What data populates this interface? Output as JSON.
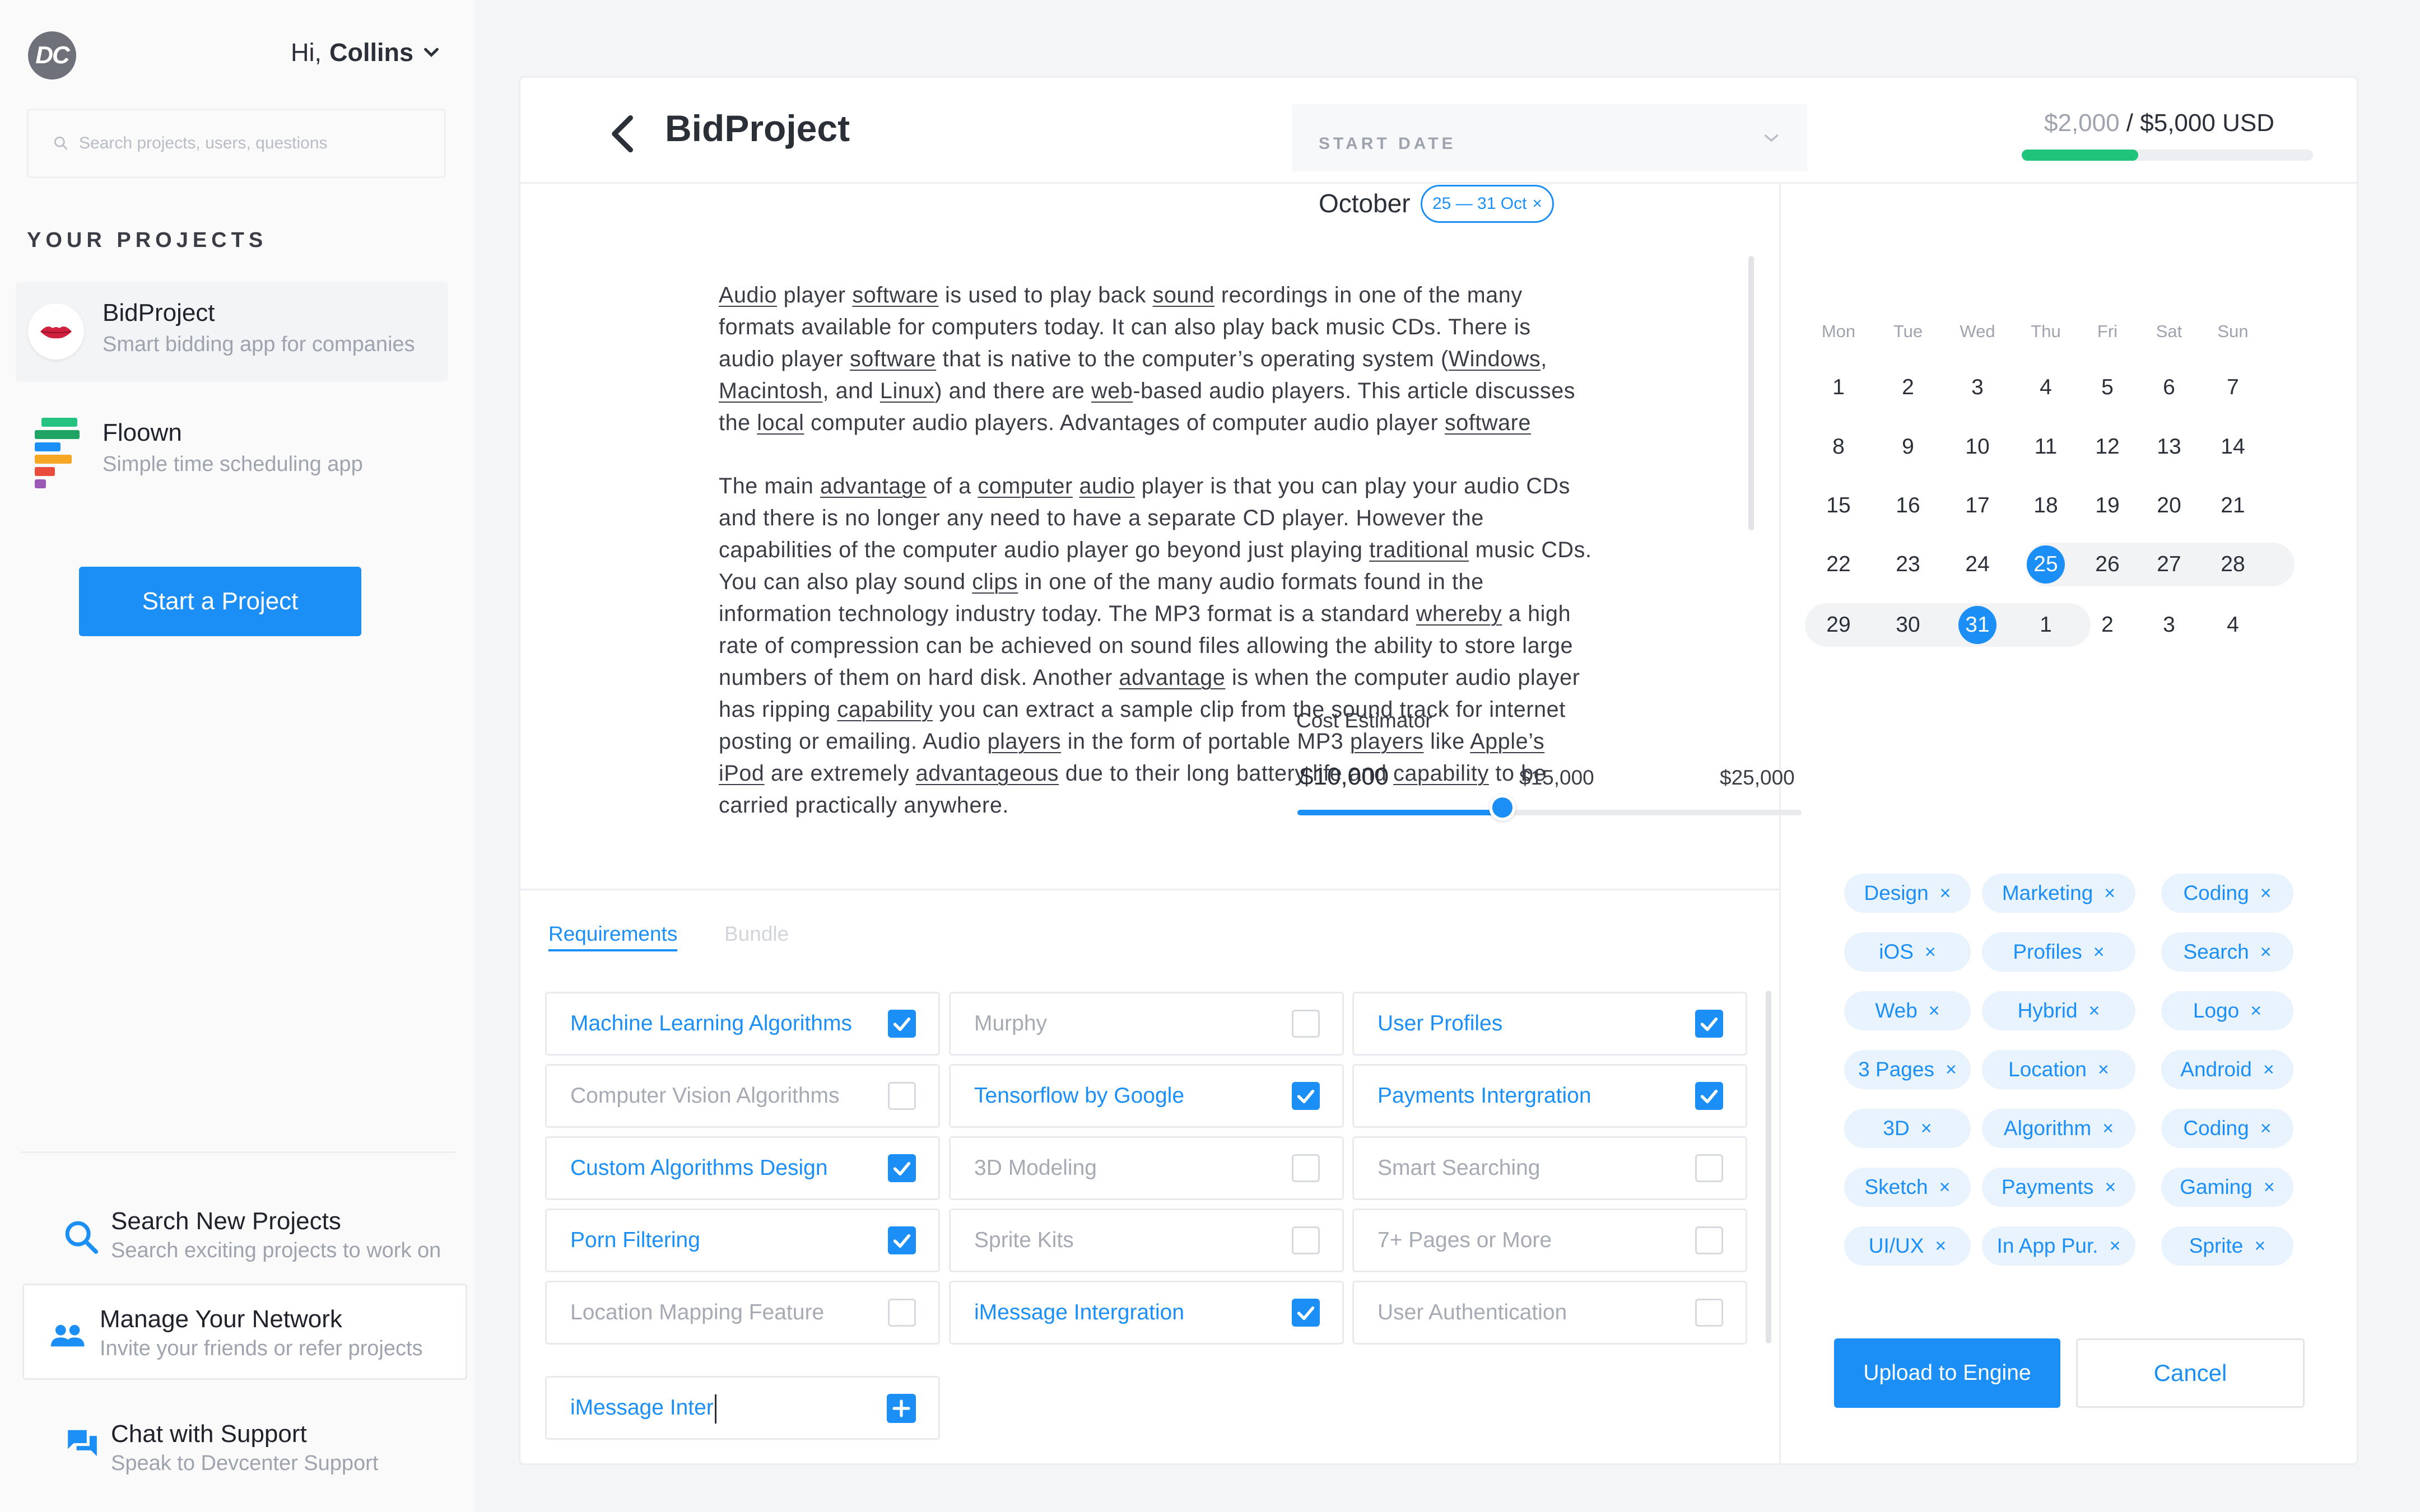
{
  "user": {
    "initials": "DC",
    "greeting": "Hi,",
    "name": "Collins"
  },
  "search": {
    "placeholder": "Search projects, users, questions"
  },
  "projects": {
    "heading": "YOUR PROJECTS",
    "items": [
      {
        "name": "BidProject",
        "subtitle": "Smart bidding app for companies"
      },
      {
        "name": "Floown",
        "subtitle": "Simple time scheduling app"
      }
    ],
    "start_label": "Start a Project"
  },
  "side_links": [
    {
      "title": "Search New Projects",
      "subtitle": "Search exciting projects to work on",
      "icon": "search-icon"
    },
    {
      "title": "Manage Your Network",
      "subtitle": "Invite your friends or refer projects",
      "icon": "people-icon"
    },
    {
      "title": "Chat with Support",
      "subtitle": "Speak to Devcenter Support",
      "icon": "chat-icon"
    }
  ],
  "header": {
    "title": "BidProject",
    "budget_current": "$2,000",
    "budget_sep": " / ",
    "budget_total": "$5,000 USD",
    "budget_progress": 0.4
  },
  "article": {
    "p1": "Audio player software is used to play back sound recordings in one of the many formats available for computers today. It can also play back music CDs. There is audio player software that is native to the computer’s operating system (Windows, Macintosh, and Linux) and there are web-based audio players. This article discusses the local computer audio players. Advantages of computer audio player software",
    "p2": "The main advantage of a computer audio player is that you can play your audio CDs and there is no longer any need to have a separate CD player. However the capabilities of the computer audio player go beyond just playing traditional music CDs. You can also play sound clips in one of the many audio formats found in the information technology industry today. The MP3 format is a standard whereby a high rate of compression can be achieved on sound files allowing the ability to store large numbers of them on hard disk. Another advantage is when the computer audio player has ripping capability you can extract a sample clip from the sound track for internet posting or emailing. Audio players in the form of portable MP3 players like Apple’s iPod are extremely advantageous due to their long battery life and capability to be carried practically anywhere."
  },
  "tabs": {
    "requirements": "Requirements",
    "bundle": "Bundle"
  },
  "requirements": [
    {
      "label": "Machine Learning Algorithms",
      "checked": true
    },
    {
      "label": "Murphy",
      "checked": false
    },
    {
      "label": "User Profiles",
      "checked": true
    },
    {
      "label": "Computer Vision Algorithms",
      "checked": false
    },
    {
      "label": "Tensorflow by Google",
      "checked": true
    },
    {
      "label": "Payments Intergration",
      "checked": true
    },
    {
      "label": "Custom Algorithms Design",
      "checked": true
    },
    {
      "label": "3D Modeling",
      "checked": false
    },
    {
      "label": "Smart Searching",
      "checked": false
    },
    {
      "label": "Porn Filtering",
      "checked": true
    },
    {
      "label": "Sprite Kits",
      "checked": false
    },
    {
      "label": "7+ Pages or More",
      "checked": false
    },
    {
      "label": "Location Mapping Feature",
      "checked": false
    },
    {
      "label": "iMessage Intergration",
      "checked": true
    },
    {
      "label": "User Authentication",
      "checked": false
    }
  ],
  "new_requirement": {
    "value": "iMessage Inter"
  },
  "start_date": {
    "label": "START DATE",
    "month": "October",
    "range": "25 — 31 Oct",
    "weekdays": [
      "Mon",
      "Tue",
      "Wed",
      "Thu",
      "Fri",
      "Sat",
      "Sun"
    ],
    "weeks": [
      [
        "1",
        "2",
        "3",
        "4",
        "5",
        "6",
        "7"
      ],
      [
        "8",
        "9",
        "10",
        "11",
        "12",
        "13",
        "14"
      ],
      [
        "15",
        "16",
        "17",
        "18",
        "19",
        "20",
        "21"
      ],
      [
        "22",
        "23",
        "24",
        "25",
        "26",
        "27",
        "28"
      ],
      [
        "29",
        "30",
        "31",
        "1",
        "2",
        "3",
        "4"
      ]
    ],
    "selected": [
      "25",
      "31"
    ]
  },
  "cost_estimator": {
    "label": "Cost Estimator",
    "min": "$10,000",
    "value": "$15,000",
    "max": "$25,000"
  },
  "tags": [
    "Design",
    "Marketing",
    "Coding",
    "iOS",
    "Profiles",
    "Search",
    "Web",
    "Hybrid",
    "Logo",
    "3 Pages",
    "Location",
    "Android",
    "3D",
    "Algorithm",
    "Coding",
    "Sketch",
    "Payments",
    "Gaming",
    "UI/UX",
    "In App Pur.",
    "Sprite"
  ],
  "actions": {
    "upload": "Upload to Engine",
    "cancel": "Cancel"
  },
  "colors": {
    "accent": "#1b8ff5",
    "progress": "#1fc37a"
  }
}
